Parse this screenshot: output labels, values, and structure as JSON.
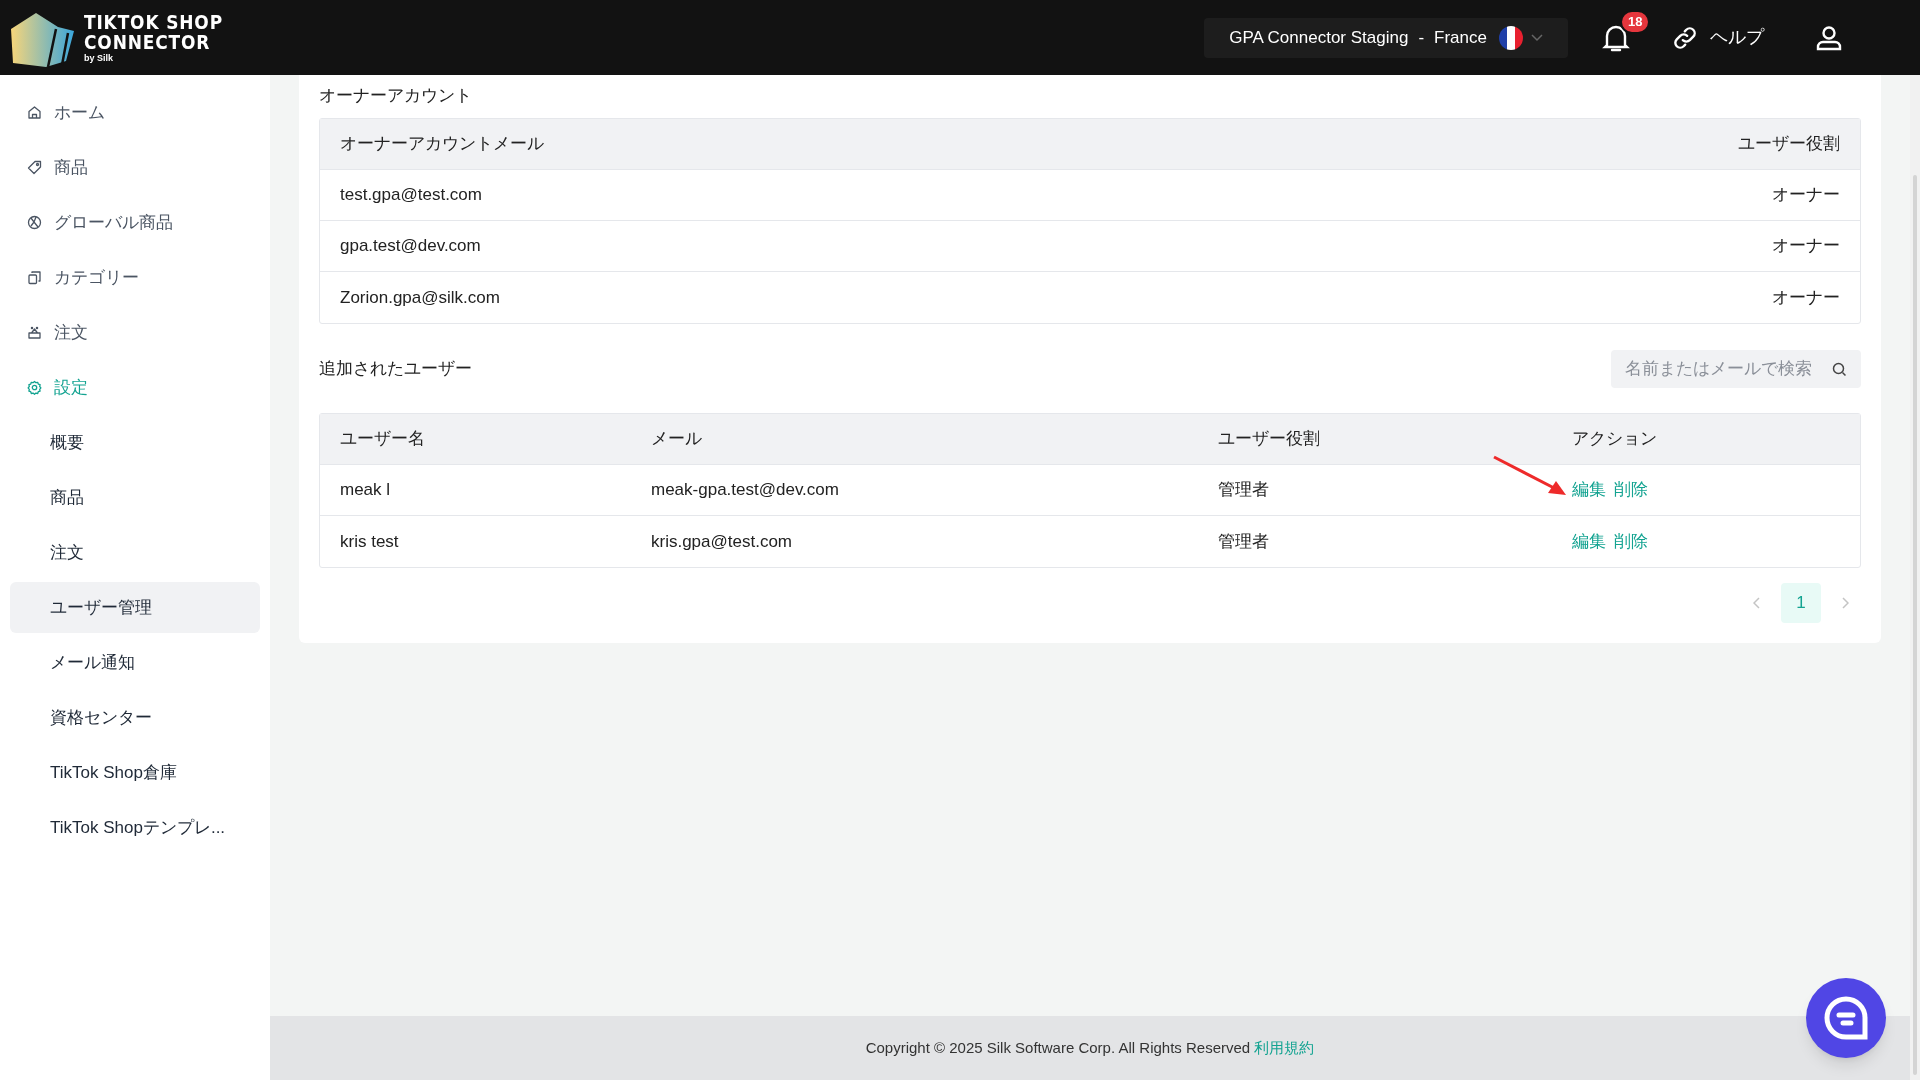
{
  "header": {
    "logo": {
      "line_1": "TIKTOK SHOP",
      "line_2": "CONNECTOR",
      "byline": "by Silk"
    },
    "store_selector": {
      "store": "GPA Connector Staging",
      "separator": "-",
      "country": "France"
    },
    "notifications": {
      "count": "18"
    },
    "help": {
      "label": "ヘルプ"
    }
  },
  "sidebar": {
    "items": [
      {
        "label": "ホーム",
        "selected": false
      },
      {
        "label": "商品",
        "selected": false
      },
      {
        "label": "グローバル商品",
        "selected": false
      },
      {
        "label": "カテゴリー",
        "selected": false
      },
      {
        "label": "注文",
        "selected": false
      },
      {
        "label": "設定",
        "selected": true,
        "children": [
          {
            "label": "概要",
            "selected": false
          },
          {
            "label": "商品",
            "selected": false
          },
          {
            "label": "注文",
            "selected": false
          },
          {
            "label": "ユーザー管理",
            "selected": true
          },
          {
            "label": "メール通知",
            "selected": false
          },
          {
            "label": "資格センター",
            "selected": false
          },
          {
            "label": "TikTok Shop倉庫",
            "selected": false
          },
          {
            "label": "TikTok Shopテンプレ...",
            "selected": false
          }
        ]
      }
    ]
  },
  "owner_accounts": {
    "title": "オーナーアカウント",
    "columns": [
      "オーナーアカウントメール",
      "ユーザー役割"
    ],
    "rows": [
      {
        "email": "test.gpa@test.com",
        "role": "オーナー"
      },
      {
        "email": "gpa.test@dev.com",
        "role": "オーナー"
      },
      {
        "email": "Zorion.gpa@silk.com",
        "role": "オーナー"
      }
    ]
  },
  "added_users": {
    "title": "追加されたユーザー",
    "search": {
      "placeholder": "名前またはメールで検索"
    },
    "columns": [
      "ユーザー名",
      "メール",
      "ユーザー役割",
      "アクション"
    ],
    "rows": [
      {
        "name": "meak l",
        "email": "meak-gpa.test@dev.com",
        "role": "管理者",
        "actions": [
          "編集",
          "削除"
        ],
        "annotated": true
      },
      {
        "name": "kris test",
        "email": "kris.gpa@test.com",
        "role": "管理者",
        "actions": [
          "編集",
          "削除"
        ],
        "annotated": false
      }
    ],
    "pagination": {
      "pages": [
        {
          "label": "1",
          "selected": true
        }
      ]
    }
  },
  "footer": {
    "copyright": "Copyright © 2025 Silk Software Corp. All Rights Reserved",
    "link": "利用規約"
  }
}
